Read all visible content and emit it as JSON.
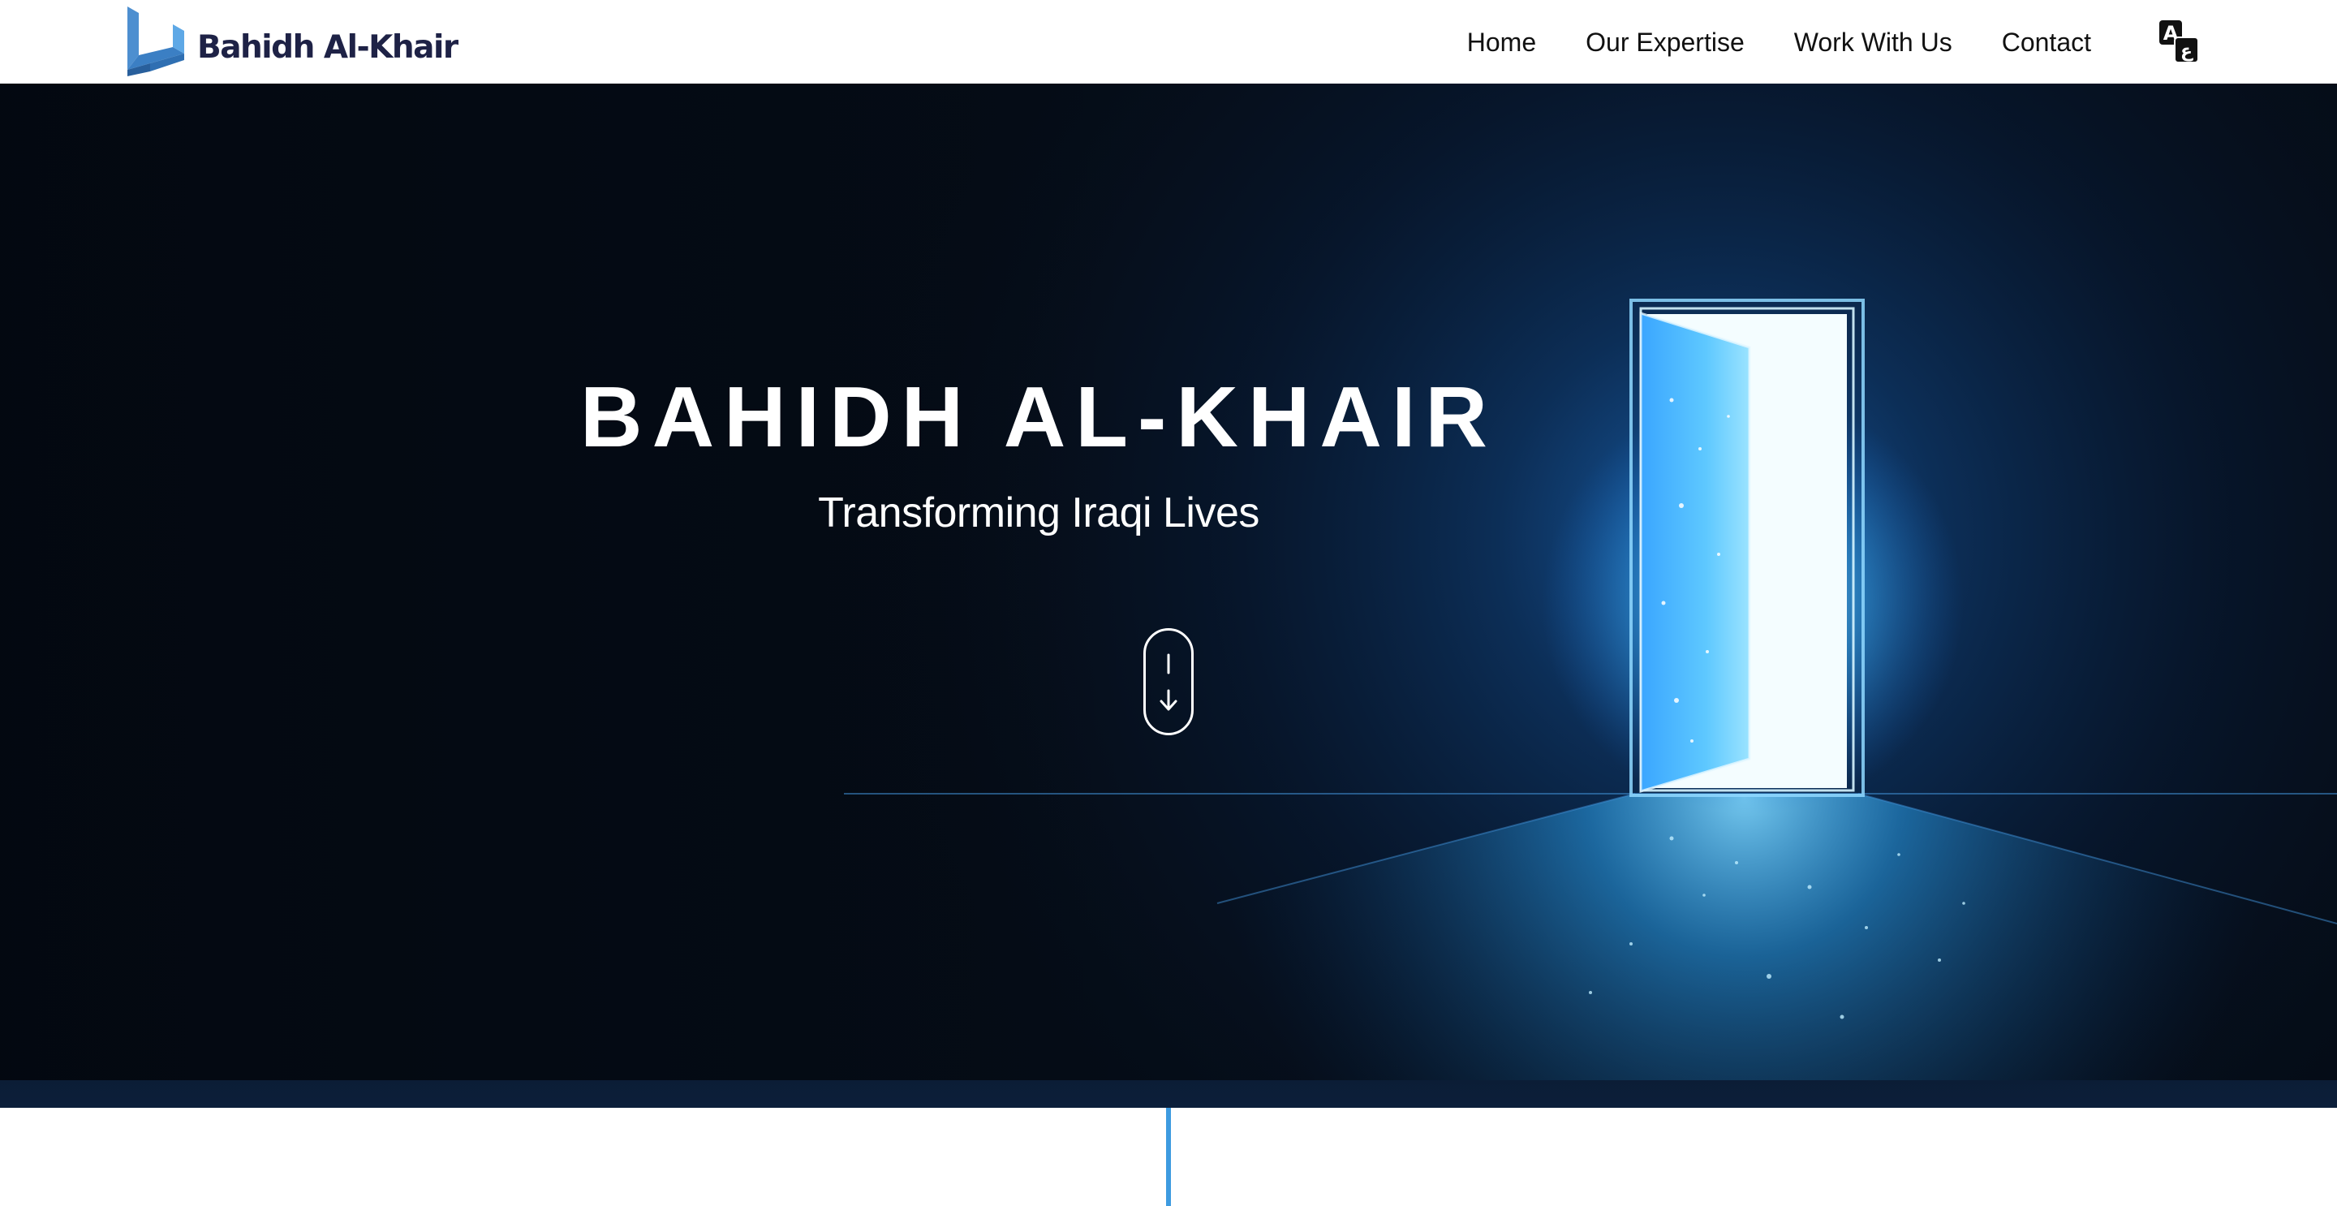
{
  "header": {
    "brand_name": "Bahidh Al-Khair",
    "logo_icon": "logo-mark-icon",
    "nav": [
      {
        "label": "Home"
      },
      {
        "label": "Our Expertise"
      },
      {
        "label": "Work With Us"
      },
      {
        "label": "Contact"
      }
    ],
    "language_icon": "translate-icon"
  },
  "hero": {
    "title": "BAHIDH AL-KHAIR",
    "subtitle": "Transforming Iraqi Lives",
    "scroll_icon": "scroll-down-arrow-icon"
  },
  "colors": {
    "brand_navy": "#1e2246",
    "brand_blue": "#3e9be0",
    "hero_background": "#050c16",
    "door_glow": "#4fc3ff"
  }
}
